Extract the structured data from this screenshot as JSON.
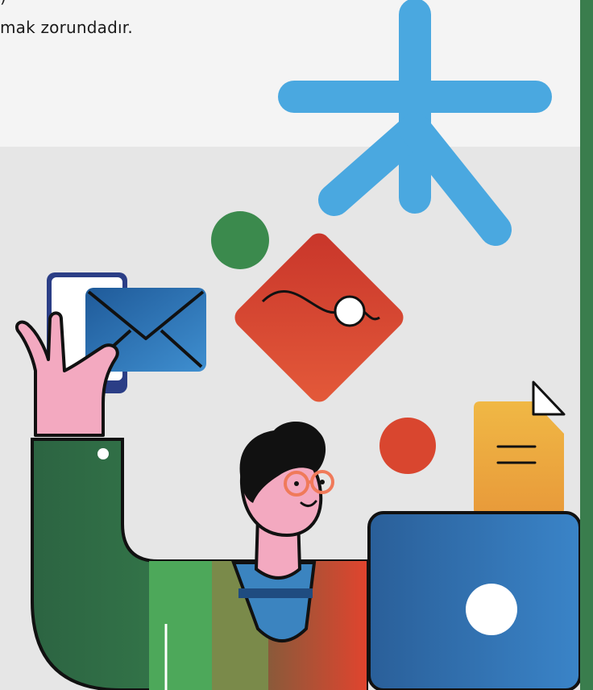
{
  "text": {
    "cut_line": ")",
    "body_line": "mak zorundadır."
  },
  "colors": {
    "panel": "#f4f4f4",
    "scene_bg": "#e6e6e6",
    "edge_bar": "#3a7d4d",
    "asterisk": "#4aa8e0",
    "accent_red": "#d9462f",
    "accent_green": "#3b8a4d",
    "envelope": "#2b6fae",
    "document": "#f0b040",
    "laptop": "#2d6aa6",
    "skin": "#f3a9c0"
  },
  "icons": [
    "asterisk-icon",
    "envelope-icon",
    "photo-icon",
    "document-icon",
    "laptop-icon"
  ]
}
